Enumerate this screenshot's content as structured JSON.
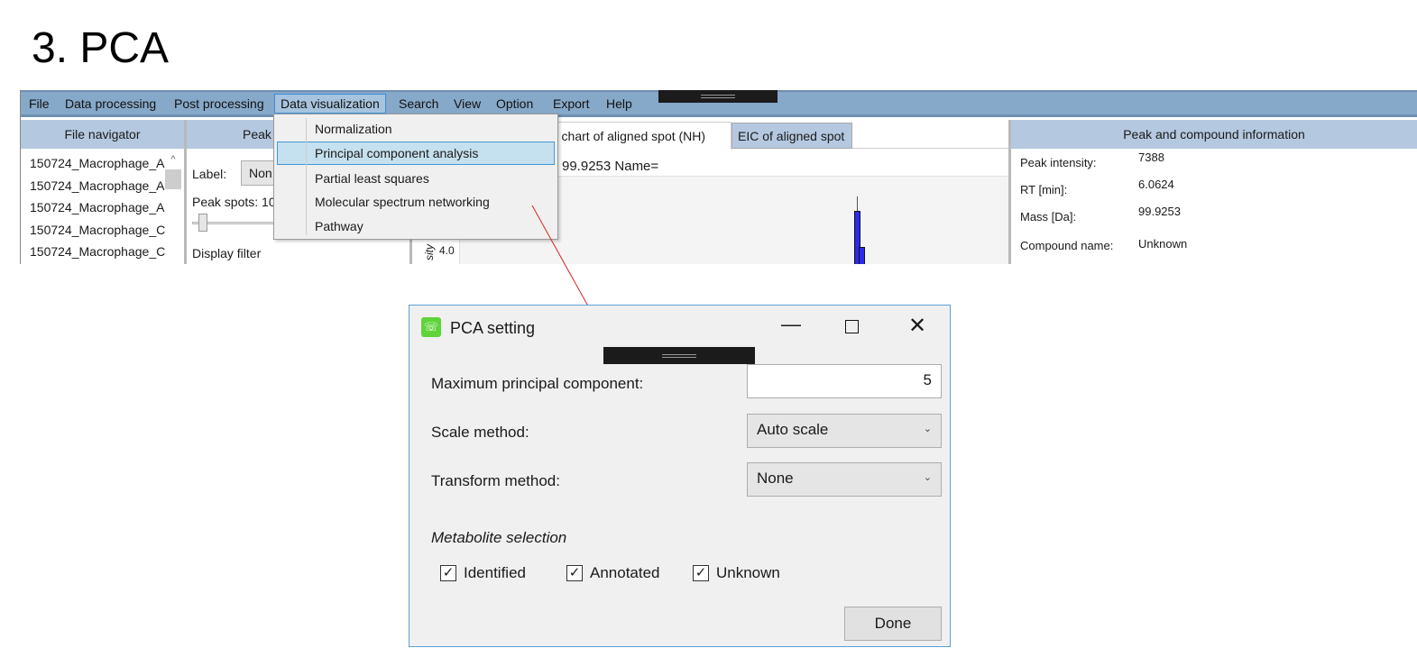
{
  "page_title": "3. PCA",
  "menu": [
    "File",
    "Data processing",
    "Post processing",
    "Data visualization",
    "Search",
    "View",
    "Option",
    "Export",
    "Help"
  ],
  "panels": {
    "file_navigator": "File navigator",
    "peak": "Peak",
    "right": "Peak and compound information"
  },
  "files": [
    "150724_Macrophage_A",
    "150724_Macrophage_A",
    "150724_Macrophage_A",
    "150724_Macrophage_C",
    "150724_Macrophage_C"
  ],
  "peak_panel": {
    "label": "Label:",
    "label_value": "Non",
    "peak_spots": "Peak spots: 10",
    "display_filter": "Display filter"
  },
  "tabs": [
    "r chart of aligned spot (NH)",
    "EIC of aligned spot"
  ],
  "chart_header": "99.9253 Name=",
  "chart_axis": {
    "ylabel": "sity",
    "tick": "4.0"
  },
  "dropdown": [
    "Normalization",
    "Principal component analysis",
    "Partial least squares",
    "Molecular spectrum networking",
    "Pathway"
  ],
  "info": [
    {
      "label": "Peak intensity:",
      "value": "7388"
    },
    {
      "label": "RT [min]:",
      "value": "6.0624"
    },
    {
      "label": "Mass [Da]:",
      "value": "99.9253"
    },
    {
      "label": "Compound name:",
      "value": "Unknown"
    }
  ],
  "dialog": {
    "title": "PCA setting",
    "max_pc_label": "Maximum principal component:",
    "max_pc_value": "5",
    "scale_label": "Scale method:",
    "scale_value": "Auto scale",
    "transform_label": "Transform method:",
    "transform_value": "None",
    "metabolite_selection": "Metabolite selection",
    "checkboxes": [
      {
        "label": "Identified",
        "checked": true
      },
      {
        "label": "Annotated",
        "checked": true
      },
      {
        "label": "Unknown",
        "checked": true
      }
    ],
    "done": "Done"
  },
  "colors": {
    "menubar": "#86a8c9",
    "panel_header": "#b4c8e0",
    "highlight": "#c5e0ee",
    "arrow": "#e02020",
    "bar": "#2b2bf0"
  }
}
